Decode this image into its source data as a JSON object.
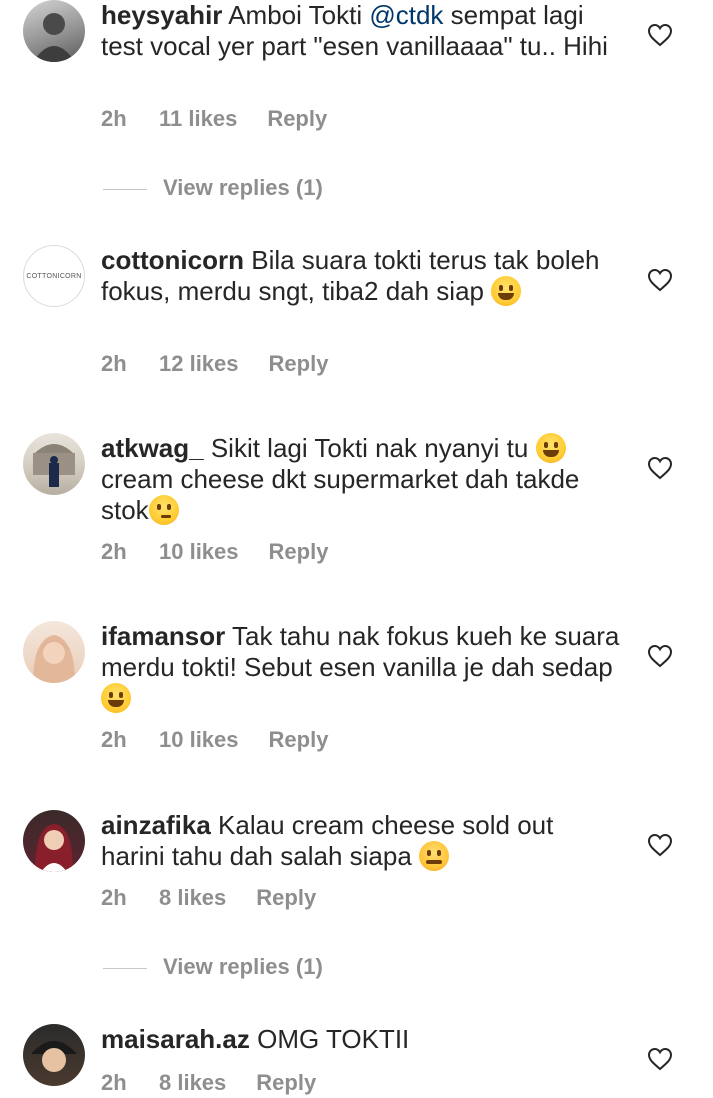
{
  "comments": [
    {
      "username": "heysyahir",
      "text_before": " Amboi Tokti ",
      "mention": "@ctdk",
      "text_after": " sempat lagi test vocal yer part \"esen vanillaaaa\" tu.. Hihi",
      "time": "2h",
      "likes": "11 likes",
      "reply": "Reply",
      "view_replies": "View replies (1)"
    },
    {
      "username": "cottonicorn",
      "text": " Bila suara tokti terus tak boleh fokus, merdu sngt, tiba2 dah siap ",
      "emoji": "grinning-sweat-emoji",
      "avatar_text": "COTTONICORN",
      "time": "2h",
      "likes": "12 likes",
      "reply": "Reply"
    },
    {
      "username": "atkwag_",
      "text_before": " Sikit lagi Tokti nak nyanyi tu ",
      "text_after": " cream cheese dkt supermarket dah takde stok",
      "emoji1": "tears-of-joy-emoji",
      "emoji2": "thinking-emoji",
      "time": "2h",
      "likes": "10 likes",
      "reply": "Reply"
    },
    {
      "username": "ifamansor",
      "text": " Tak tahu nak fokus kueh ke suara merdu tokti! Sebut esen vanilla je dah sedap ",
      "emoji": "squinting-laugh-emoji",
      "time": "2h",
      "likes": "10 likes",
      "reply": "Reply"
    },
    {
      "username": "ainzafika",
      "text": " Kalau cream cheese sold out harini tahu dah salah siapa ",
      "emoji": "triumph-emoji",
      "time": "2h",
      "likes": "8 likes",
      "reply": "Reply",
      "view_replies": "View replies (1)"
    },
    {
      "username": "maisarah.az",
      "text": " OMG TOKTII",
      "time": "2h",
      "likes": "8 likes",
      "reply": "Reply"
    }
  ],
  "colors": {
    "text": "#262626",
    "muted": "#8e8e8e",
    "mention": "#00376b"
  }
}
